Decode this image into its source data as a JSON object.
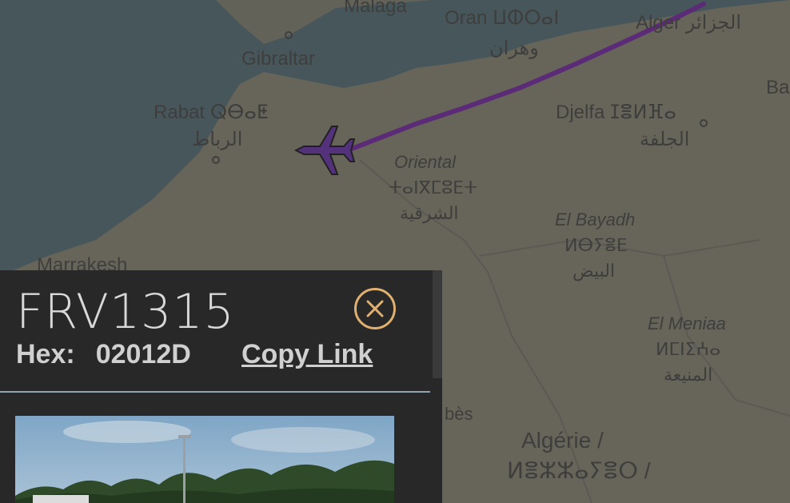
{
  "map": {
    "labels": {
      "malaga": "Malaga",
      "oran": "Oran ⵡⵀⵔⴰⵏ",
      "oran_ar": "وهران",
      "alger": "Alger الجزائر",
      "gibraltar": "Gibraltar",
      "rabat": "Rabat ⵕⴱⴰⵟ",
      "rabat_ar": "الرباط",
      "djelfa": "Djelfa ⵊⴻⵍⴼⴰ",
      "djelfa_ar": "الجلفة",
      "oriental": "Oriental",
      "oriental_tfng": "ⵜⴰⵏⴳⵎⵓⴹⵜ",
      "oriental_ar": "الشرقية",
      "el_bayadh": "El Bayadh",
      "el_bayadh_tfng": "ⵍⴱⵢⴻⴹ",
      "el_bayadh_ar": "البيض",
      "el_meniaa": "El Meniaa",
      "el_meniaa_tfng": "ⵍⵎⵏⵉⵄⴰ",
      "el_meniaa_ar": "المنيعة",
      "marrakesh": "Marrakesh",
      "algerie": "Algérie /",
      "algerie_tfng": "ⵍⴻⵣⵣⴰⵢⴻⵔ /",
      "ba": "Ba",
      "bes": "bès"
    }
  },
  "flight": {
    "callsign": "FRV1315",
    "hex_label": "Hex:",
    "hex_value": "02012D",
    "copy_link_label": "Copy Link"
  },
  "colors": {
    "track": "#9b30d8",
    "aircraft": "#8a3fe0",
    "close_ring": "#e0b070"
  }
}
